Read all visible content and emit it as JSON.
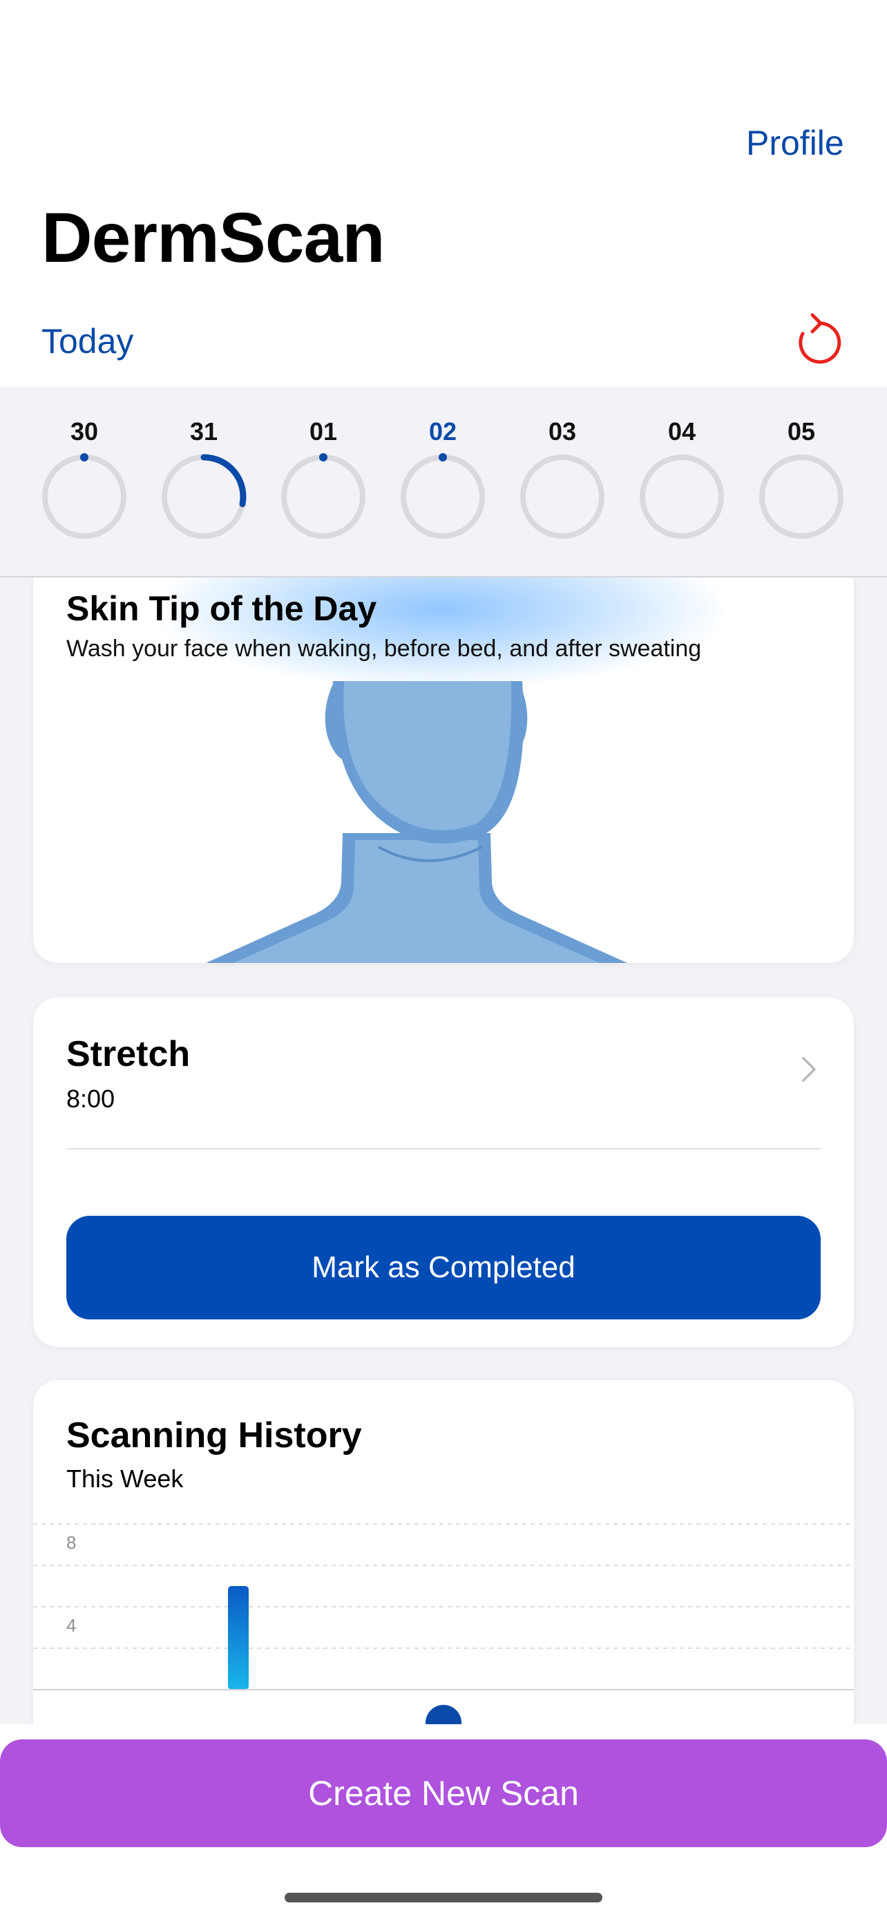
{
  "header": {
    "profile_label": "Profile",
    "app_title": "DermScan",
    "today_label": "Today",
    "refresh_icon": "refresh-icon",
    "refresh_color": "#e8231d"
  },
  "date_strip": {
    "selected": "02",
    "days": [
      {
        "label": "30",
        "progress": 0.0,
        "has_dot": true
      },
      {
        "label": "31",
        "progress": 0.28,
        "has_dot": true
      },
      {
        "label": "01",
        "progress": 0.0,
        "has_dot": true
      },
      {
        "label": "02",
        "progress": 0.0,
        "has_dot": true
      },
      {
        "label": "03",
        "progress": 0.0,
        "has_dot": false
      },
      {
        "label": "04",
        "progress": 0.0,
        "has_dot": false
      },
      {
        "label": "05",
        "progress": 0.0,
        "has_dot": false
      }
    ]
  },
  "tip_card": {
    "title": "Skin Tip of the Day",
    "text": "Wash your face when waking, before bed, and after sweating"
  },
  "task_card": {
    "title": "Stretch",
    "time": "8:00",
    "complete_label": "Mark as Completed"
  },
  "history_card": {
    "title": "Scanning History",
    "subtitle": "This Week"
  },
  "chart_data": {
    "type": "bar",
    "y_ticks": [
      "8",
      "4"
    ],
    "ylim": [
      0,
      8
    ],
    "values": [
      0,
      5,
      0,
      0,
      0,
      0,
      0
    ]
  },
  "bottom": {
    "create_label": "Create New Scan"
  },
  "colors": {
    "accent": "#0a4aa8",
    "button_blue": "#004bb4",
    "create_purple": "#af52de",
    "ring_gray": "#d9d9de"
  }
}
